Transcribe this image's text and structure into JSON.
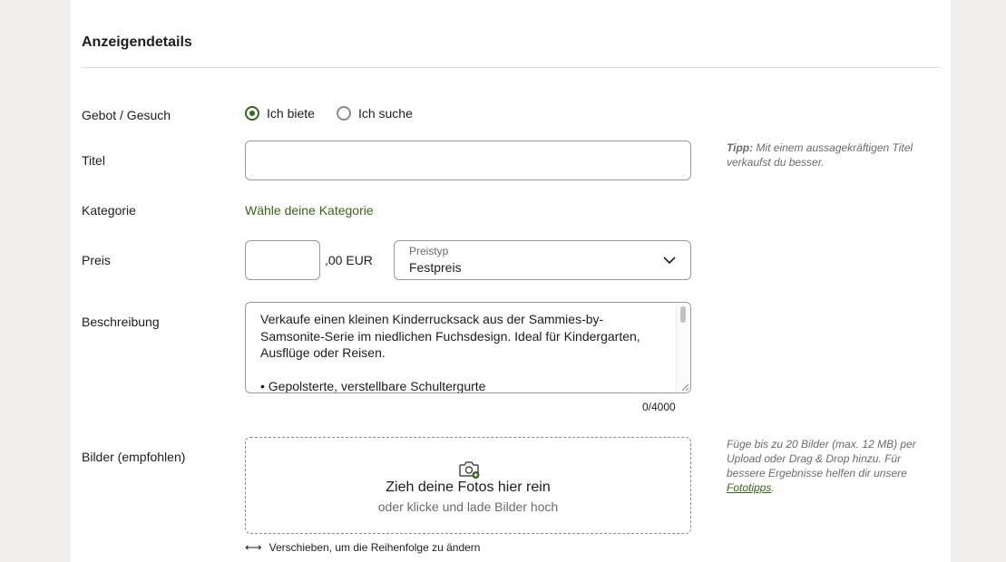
{
  "section": {
    "title": "Anzeigendetails"
  },
  "offer_type": {
    "label": "Gebot / Gesuch",
    "options": [
      {
        "label": "Ich biete",
        "checked": true
      },
      {
        "label": "Ich suche",
        "checked": false
      }
    ]
  },
  "title_field": {
    "label": "Titel",
    "value": "",
    "tip_bold": "Tipp:",
    "tip_text": " Mit einem aussagekräftigen Titel verkaufst du besser."
  },
  "category": {
    "label": "Kategorie",
    "link": "Wähle deine Kategorie"
  },
  "price": {
    "label": "Preis",
    "value": "",
    "suffix": ",00 EUR",
    "type_label": "Preistyp",
    "type_value": "Festpreis"
  },
  "description": {
    "label": "Beschreibung",
    "value": "Verkaufe einen kleinen Kinderrucksack aus der Sammies-by-Samsonite-Serie im niedlichen Fuchsdesign. Ideal für Kindergarten, Ausflüge oder Reisen.\n\n• Gepolsterte, verstellbare Schultergurte",
    "counter": "0/4000"
  },
  "images": {
    "label": "Bilder (empfohlen)",
    "drop_title": "Zieh deine Fotos hier rein",
    "drop_sub": "oder klicke und lade Bilder hoch",
    "tip_text": "Füge bis zu 20 Bilder (max. 12 MB) per Upload oder Drag & Drop hinzu. Für bessere Ergebnisse helfen dir unsere ",
    "tip_link": "Fototipps",
    "tip_end": ".",
    "reorder_text": "Verschieben, um die Reihenfolge zu ändern"
  },
  "colors": {
    "accent": "#326916",
    "border": "#999999",
    "muted": "#6b6b6b"
  },
  "icons": {
    "camera": "camera-icon",
    "chevron": "chevron-down-icon",
    "reorder": "arrows-horizontal-icon"
  }
}
